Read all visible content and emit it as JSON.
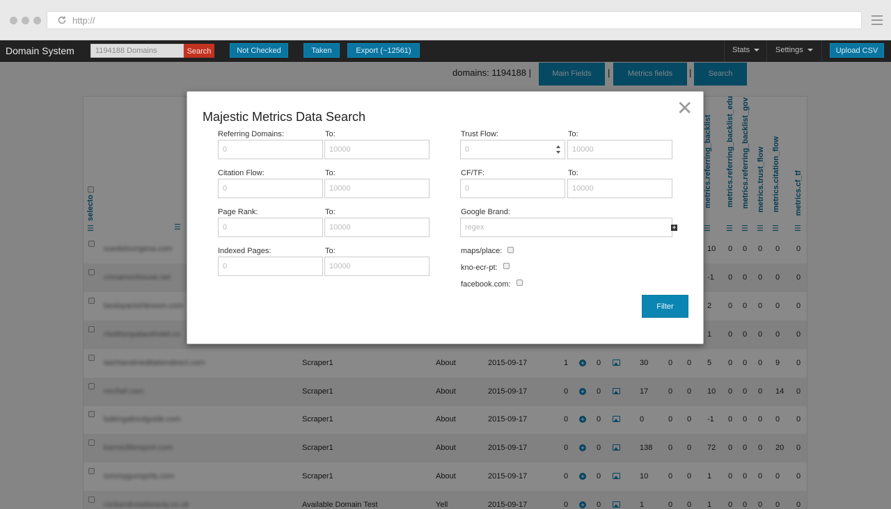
{
  "browser": {
    "url": "http://"
  },
  "navbar": {
    "brand": "Domain System",
    "search_placeholder": "1194188 Domains",
    "search_button": "Search",
    "buttons": [
      "Not Checked",
      "Taken",
      "Export (~12561)"
    ],
    "stats": "Stats",
    "settings": "Settings",
    "upload": "Upload CSV"
  },
  "toolbar": {
    "domains_count": "domains: 1194188 |",
    "pipe": "|",
    "tabs": [
      "Main Fields",
      "Metrics fields",
      "Search"
    ]
  },
  "table": {
    "headers": [
      "selecto",
      "metrics.referring_backlist",
      "metrics.referring_backlist_edu",
      "metrics.referring_backlist_gov",
      "metrics.trust_flow",
      "metrics.citation_flow",
      "metrics.cf_tf"
    ],
    "rows": [
      {
        "domain": "suedeloungesa.com",
        "source": "",
        "status": "",
        "date": "",
        "a": "",
        "b": "",
        "c": "",
        "d": "",
        "e": "",
        "f": "10",
        "g": "0",
        "h": "0",
        "i": "0",
        "j": "0",
        "k": "0"
      },
      {
        "domain": "cinnamonhouse.net",
        "source": "",
        "status": "",
        "date": "",
        "a": "",
        "b": "",
        "c": "",
        "d": "",
        "e": "",
        "f": "-1",
        "g": "0",
        "h": "0",
        "i": "0",
        "j": "0",
        "k": "0"
      },
      {
        "domain": "bestspanishlesson.com",
        "source": "",
        "status": "",
        "date": "",
        "a": "",
        "b": "",
        "c": "",
        "d": "",
        "e": "",
        "f": "2",
        "g": "0",
        "h": "0",
        "i": "0",
        "j": "0",
        "k": "0"
      },
      {
        "domain": "risothonpalacehotel.co",
        "source": "",
        "status": "",
        "date": "",
        "a": "",
        "b": "",
        "c": "",
        "d": "",
        "e": "",
        "f": "1",
        "g": "0",
        "h": "0",
        "i": "0",
        "j": "0",
        "k": "0"
      },
      {
        "domain": "taichiandmeditationdirect.com",
        "source": "Scraper1",
        "status": "About",
        "date": "2015-09-17",
        "a": "1",
        "b": "0",
        "c": "30",
        "d": "0",
        "e": "0",
        "f": "5",
        "g": "0",
        "h": "0",
        "i": "0",
        "j": "9",
        "k": "0"
      },
      {
        "domain": "mrchef.com",
        "source": "Scraper1",
        "status": "About",
        "date": "2015-09-17",
        "a": "0",
        "b": "0",
        "c": "17",
        "d": "0",
        "e": "0",
        "f": "10",
        "g": "0",
        "h": "0",
        "i": "0",
        "j": "14",
        "k": "0"
      },
      {
        "domain": "bakingaboutguide.com",
        "source": "Scraper1",
        "status": "About",
        "date": "2015-09-17",
        "a": "0",
        "b": "0",
        "c": "0",
        "d": "0",
        "e": "0",
        "f": "-1",
        "g": "0",
        "h": "0",
        "i": "0",
        "j": "0",
        "k": "0"
      },
      {
        "domain": "karmiclifereport.com",
        "source": "Scraper1",
        "status": "About",
        "date": "2015-09-17",
        "a": "0",
        "b": "0",
        "c": "138",
        "d": "0",
        "e": "0",
        "f": "72",
        "g": "0",
        "h": "0",
        "i": "0",
        "j": "20",
        "k": "0"
      },
      {
        "domain": "tommygunsprits.com",
        "source": "Scraper1",
        "status": "About",
        "date": "2015-09-17",
        "a": "0",
        "b": "0",
        "c": "10",
        "d": "0",
        "e": "0",
        "f": "1",
        "g": "0",
        "h": "0",
        "i": "0",
        "j": "0",
        "k": "0"
      },
      {
        "domain": "rockandrosebeauty.co.uk",
        "source": "Available Domain Test",
        "status": "Yell",
        "date": "2015-09-17",
        "a": "0",
        "b": "0",
        "c": "1",
        "d": "0",
        "e": "0",
        "f": "1",
        "g": "0",
        "h": "0",
        "i": "0",
        "j": "0",
        "k": "0"
      }
    ]
  },
  "modal": {
    "title": "Majestic Metrics Data Search",
    "close": "✕",
    "to": "To:",
    "left_fields": [
      {
        "label": "Referring Domains:",
        "from": "0",
        "to": "10000"
      },
      {
        "label": "Citation Flow:",
        "from": "0",
        "to": "10000"
      },
      {
        "label": "Page Rank:",
        "from": "0",
        "to": "10000"
      },
      {
        "label": "Indexed Pages:",
        "from": "0",
        "to": "10000"
      }
    ],
    "right_fields": [
      {
        "label": "Trust Flow:",
        "from": "0",
        "to": "10000"
      },
      {
        "label": "CF/TF:",
        "from": "0",
        "to": "10000"
      }
    ],
    "google_brand": {
      "label": "Google Brand:",
      "placeholder": "regex"
    },
    "checkboxes": [
      "maps/place:",
      "kno-ecr-pt:",
      "facebook.com:"
    ],
    "filter_button": "Filter"
  }
}
